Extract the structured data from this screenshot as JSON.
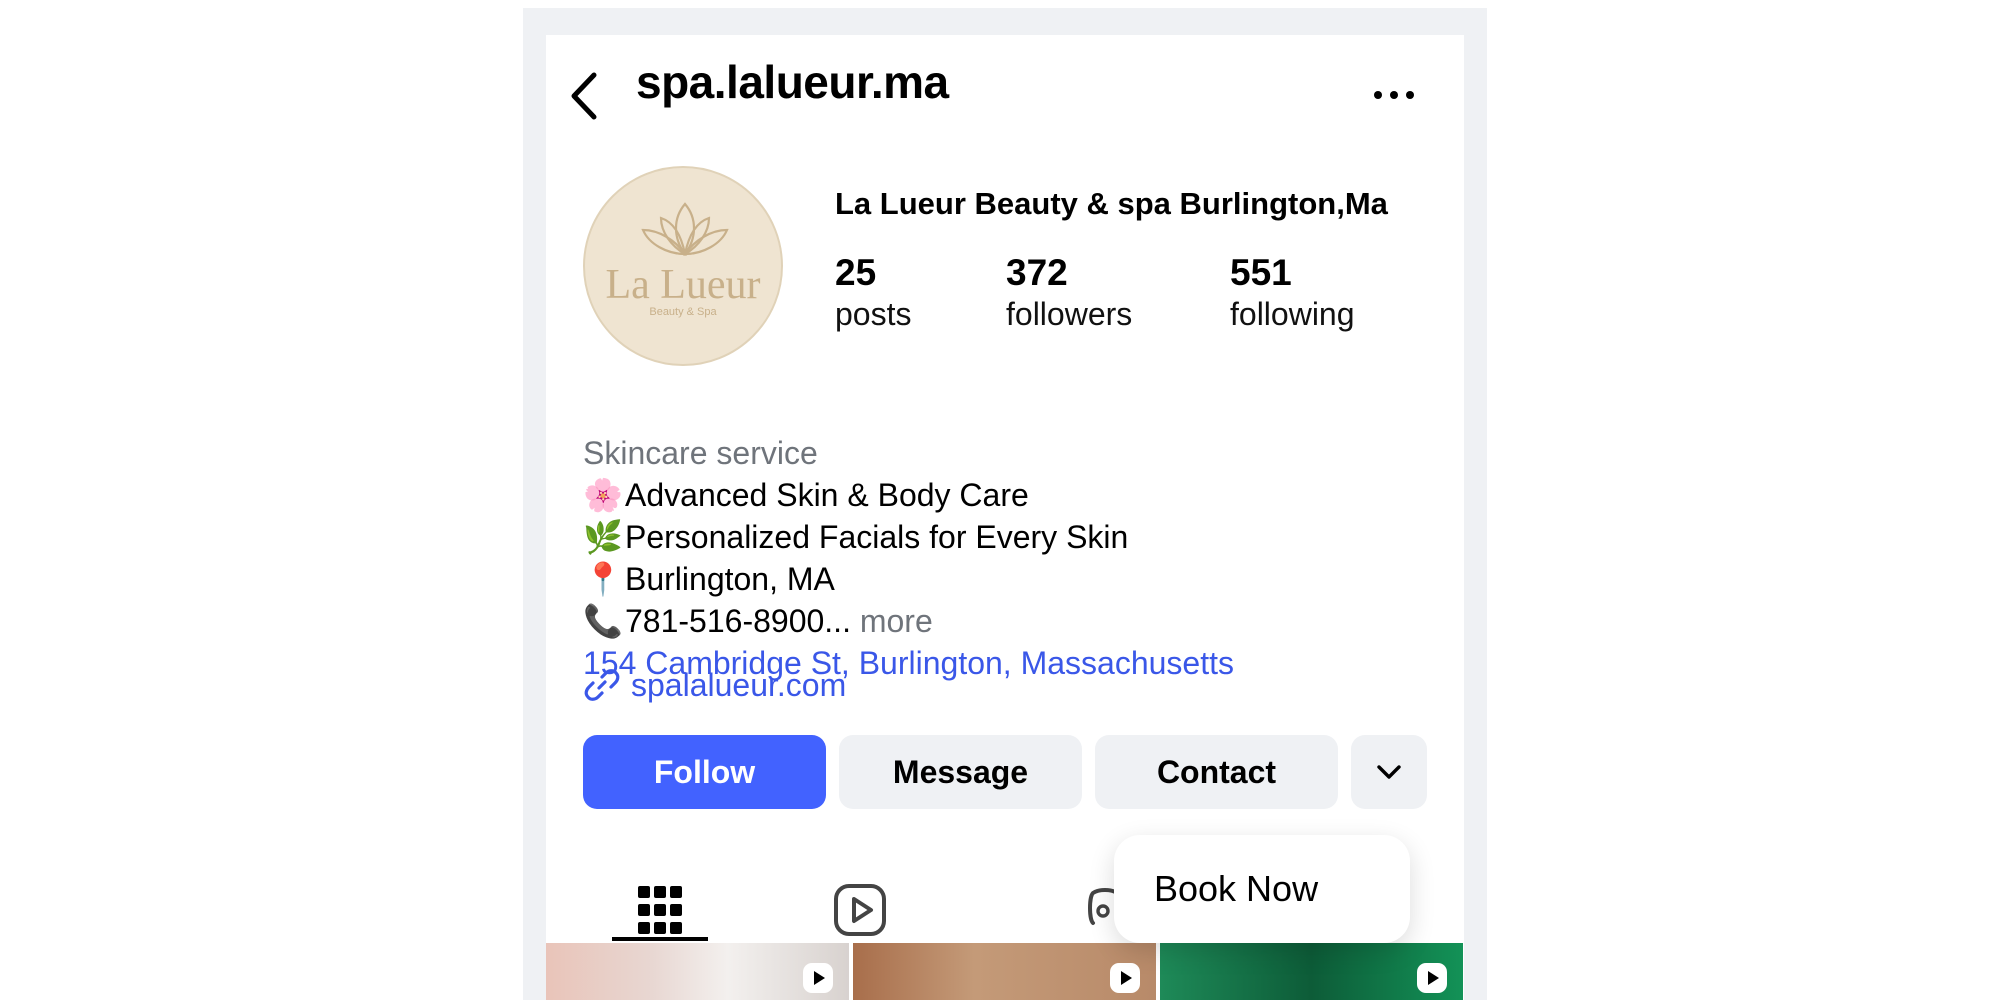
{
  "header": {
    "username": "spa.lalueur.ma"
  },
  "profile": {
    "avatar_text": "La Lueur",
    "avatar_subtext": "Beauty & Spa",
    "display_name": "La Lueur Beauty & spa Burlington,Ma",
    "stats": [
      {
        "value": "25",
        "label": "posts"
      },
      {
        "value": "372",
        "label": "followers"
      },
      {
        "value": "551",
        "label": "following"
      }
    ]
  },
  "bio": {
    "category": "Skincare service",
    "lines": [
      {
        "emoji": "🌸",
        "text": "Advanced Skin & Body Care"
      },
      {
        "emoji": "🌿",
        "text": "Personalized Facials for Every Skin"
      },
      {
        "emoji": "📍",
        "text": "Burlington, MA"
      },
      {
        "emoji": "📞",
        "text": "781-516-8900..."
      }
    ],
    "more_label": "more",
    "address": "154 Cambridge St, Burlington, Massachusetts",
    "website": "spalalueur.com"
  },
  "actions": {
    "follow": "Follow",
    "message": "Message",
    "contact": "Contact"
  },
  "popup": {
    "book_now": "Book Now"
  },
  "colors": {
    "accent": "#4262ff",
    "link": "#3a57e8",
    "button_bg": "#eff1f4",
    "muted_text": "#6f747b"
  },
  "icons": {
    "back": "chevron-left-icon",
    "more": "ellipsis-icon",
    "link": "link-icon",
    "dropdown": "chevron-down-icon",
    "grid": "grid-icon",
    "reels": "reels-icon",
    "tagged": "tagged-icon",
    "reel_badge": "play-icon"
  }
}
